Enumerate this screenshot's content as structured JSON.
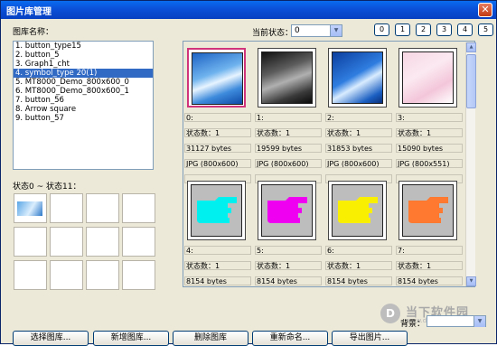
{
  "window": {
    "title": "图片库管理"
  },
  "library": {
    "label": "图库名称：",
    "items": [
      "1. button_type15",
      "2. button_5",
      "3. Graph1_cht",
      "4. symbol_type 20(1)",
      "5. MT8000_Demo_800x600_0",
      "6. MT8000_Demo_800x600_1",
      "7. button_56",
      "8. Arrow square",
      "9. button_57"
    ],
    "selected_index": 3
  },
  "state": {
    "label": "当前状态：",
    "value": "0",
    "buttons": [
      "0",
      "1",
      "2",
      "3",
      "4",
      "5"
    ]
  },
  "state_range": {
    "label": "状态0 ~ 状态11："
  },
  "gallery": {
    "items": [
      {
        "index": "0:",
        "states": "状态数：1",
        "size": "31127 bytes",
        "format": "JPG (800x600)",
        "kind": "blue"
      },
      {
        "index": "1:",
        "states": "状态数：1",
        "size": "19599 bytes",
        "format": "JPG (800x600)",
        "kind": "dark"
      },
      {
        "index": "2:",
        "states": "状态数：1",
        "size": "31853 bytes",
        "format": "JPG (800x600)",
        "kind": "blue2"
      },
      {
        "index": "3:",
        "states": "状态数：1",
        "size": "15090 bytes",
        "format": "JPG (800x551)",
        "kind": "pink"
      },
      {
        "index": "4:",
        "states": "状态数：1",
        "size": "8154 bytes",
        "format": "BMP (60x45)",
        "kind": "cyan"
      },
      {
        "index": "5:",
        "states": "状态数：1",
        "size": "8154 bytes",
        "format": "BMP (60x45)",
        "kind": "magenta"
      },
      {
        "index": "6:",
        "states": "状态数：1",
        "size": "8154 bytes",
        "format": "BMP (60x45)",
        "kind": "yellow"
      },
      {
        "index": "7:",
        "states": "状态数：1",
        "size": "8154 bytes",
        "format": "BMP (60x45)",
        "kind": "orange"
      }
    ],
    "selected_index": 0
  },
  "background": {
    "label": "背景："
  },
  "buttons": {
    "select": "选择图库...",
    "add": "新增图库...",
    "delete": "删除图库",
    "rename": "重新命名...",
    "export": "导出图片..."
  },
  "watermark": {
    "brand": "当下软件园",
    "url": "www.downxia.com",
    "icon": "downxia-logo-icon"
  },
  "colors": {
    "title_bar": "#0b50d8",
    "selection": "#316ac5",
    "selected_thumb_border": "#d0347a"
  }
}
